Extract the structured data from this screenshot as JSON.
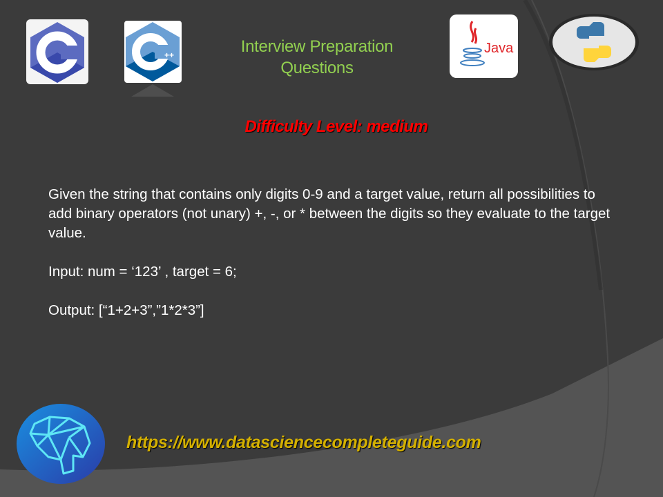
{
  "header": {
    "title_line1": "Interview Preparation",
    "title_line2": "Questions",
    "logos": [
      "c-logo-icon",
      "cpp-logo-icon",
      "java-logo-icon",
      "python-logo-icon"
    ],
    "java_logo_text": "Java",
    "cpp_logo_text": "++"
  },
  "difficulty": "Difficulty Level: medium",
  "problem": {
    "description": "Given the string that contains only digits 0-9 and a target value, return all possibilities to add binary operators (not unary) +, -, or * between the digits so they evaluate to the target value.",
    "input": "Input: num = ‘123’ , target = 6;",
    "output": "Output: [“1+2+3”,”1*2*3”]"
  },
  "footer": {
    "url": "https://www.datasciencecompleteguide.com"
  },
  "colors": {
    "background": "#3b3b3b",
    "title": "#92d050",
    "difficulty": "#ff0000",
    "url": "#d4b000"
  }
}
